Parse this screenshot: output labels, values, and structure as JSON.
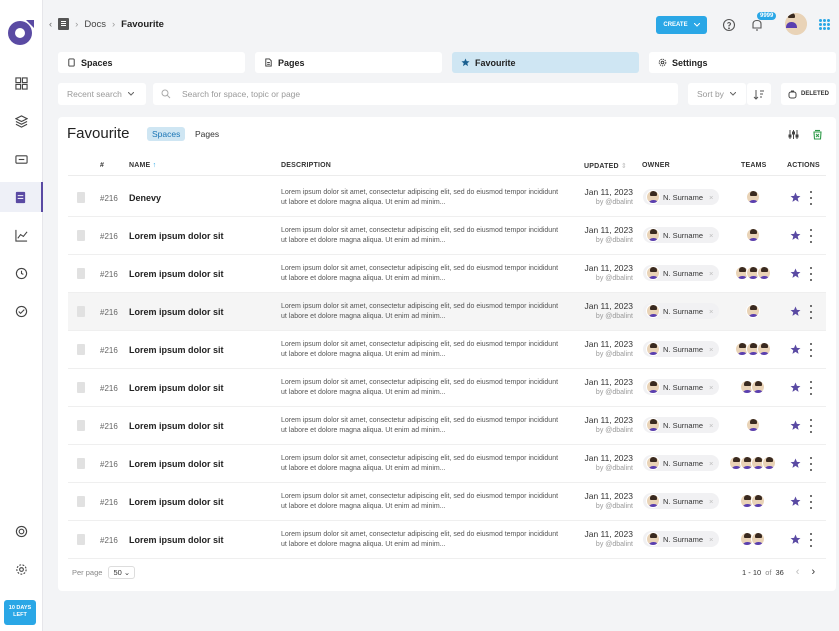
{
  "breadcrumb": {
    "section": "Docs",
    "current": "Favourite"
  },
  "header": {
    "create_label": "CREATE",
    "notification_count": "9999"
  },
  "tabs": [
    {
      "label": "Spaces",
      "icon": "square-icon"
    },
    {
      "label": "Pages",
      "icon": "document-icon"
    },
    {
      "label": "Favourite",
      "icon": "star-icon"
    },
    {
      "label": "Settings",
      "icon": "gear-icon"
    }
  ],
  "filters": {
    "recent_search": "Recent search",
    "search_placeholder": "Search for space, topic or page",
    "sort_by": "Sort by",
    "deleted_label": "DELETED"
  },
  "content": {
    "title": "Favourite",
    "subtabs": [
      "Spaces",
      "Pages"
    ],
    "columns": [
      "#",
      "NAME",
      "DESCRIPTION",
      "UPDATED",
      "OWNER",
      "TEAMS",
      "ACTIONS"
    ]
  },
  "rows": [
    {
      "id": "#216",
      "name": "Denevy",
      "desc": "Lorem ipsum dolor sit amet, consectetur adipiscing elit, sed do eiusmod tempor incididunt ut labore et dolore magna aliqua. Ut enim ad minim...",
      "date": "Jan 11, 2023",
      "by": "by @dbalint",
      "owner": "N. Surname",
      "teams": 1
    },
    {
      "id": "#216",
      "name": "Lorem ipsum dolor sit",
      "desc": "Lorem ipsum dolor sit amet, consectetur adipiscing elit, sed do eiusmod tempor incididunt ut labore et dolore magna aliqua. Ut enim ad minim...",
      "date": "Jan 11, 2023",
      "by": "by @dbalint",
      "owner": "N. Surname",
      "teams": 1
    },
    {
      "id": "#216",
      "name": "Lorem ipsum dolor sit",
      "desc": "Lorem ipsum dolor sit amet, consectetur adipiscing elit, sed do eiusmod tempor incididunt ut labore et dolore magna aliqua. Ut enim ad minim...",
      "date": "Jan 11, 2023",
      "by": "by @dbalint",
      "owner": "N. Surname",
      "teams": 3
    },
    {
      "id": "#216",
      "name": "Lorem ipsum dolor sit",
      "desc": "Lorem ipsum dolor sit amet, consectetur adipiscing elit, sed do eiusmod tempor incididunt ut labore et dolore magna aliqua. Ut enim ad minim...",
      "date": "Jan 11, 2023",
      "by": "by @dbalint",
      "owner": "N. Surname",
      "teams": 1
    },
    {
      "id": "#216",
      "name": "Lorem ipsum dolor sit",
      "desc": "Lorem ipsum dolor sit amet, consectetur adipiscing elit, sed do eiusmod tempor incididunt ut labore et dolore magna aliqua. Ut enim ad minim...",
      "date": "Jan 11, 2023",
      "by": "by @dbalint",
      "owner": "N. Surname",
      "teams": 3
    },
    {
      "id": "#216",
      "name": "Lorem ipsum dolor sit",
      "desc": "Lorem ipsum dolor sit amet, consectetur adipiscing elit, sed do eiusmod tempor incididunt ut labore et dolore magna aliqua. Ut enim ad minim...",
      "date": "Jan 11, 2023",
      "by": "by @dbalint",
      "owner": "N. Surname",
      "teams": 2
    },
    {
      "id": "#216",
      "name": "Lorem ipsum dolor sit",
      "desc": "Lorem ipsum dolor sit amet, consectetur adipiscing elit, sed do eiusmod tempor incididunt ut labore et dolore magna aliqua. Ut enim ad minim...",
      "date": "Jan 11, 2023",
      "by": "by @dbalint",
      "owner": "N. Surname",
      "teams": 1
    },
    {
      "id": "#216",
      "name": "Lorem ipsum dolor sit",
      "desc": "Lorem ipsum dolor sit amet, consectetur adipiscing elit, sed do eiusmod tempor incididunt ut labore et dolore magna aliqua. Ut enim ad minim...",
      "date": "Jan 11, 2023",
      "by": "by @dbalint",
      "owner": "N. Surname",
      "teams": 4
    },
    {
      "id": "#216",
      "name": "Lorem ipsum dolor sit",
      "desc": "Lorem ipsum dolor sit amet, consectetur adipiscing elit, sed do eiusmod tempor incididunt ut labore et dolore magna aliqua. Ut enim ad minim...",
      "date": "Jan 11, 2023",
      "by": "by @dbalint",
      "owner": "N. Surname",
      "teams": 2
    },
    {
      "id": "#216",
      "name": "Lorem ipsum dolor sit",
      "desc": "Lorem ipsum dolor sit amet, consectetur adipiscing elit, sed do eiusmod tempor incididunt ut labore et dolore magna aliqua. Ut enim ad minim...",
      "date": "Jan 11, 2023",
      "by": "by @dbalint",
      "owner": "N. Surname",
      "teams": 2
    }
  ],
  "pagination": {
    "per_page_label": "Per page",
    "per_page": "50",
    "range": "1 - 10",
    "of": "of",
    "total": "36"
  },
  "trial": {
    "line1": "10 DAYS",
    "line2": "LEFT"
  },
  "colors": {
    "accent": "#2aa7e6",
    "brand": "#5a4aa3",
    "active_tab": "#cfe6f3",
    "star": "#5a4aa3"
  }
}
